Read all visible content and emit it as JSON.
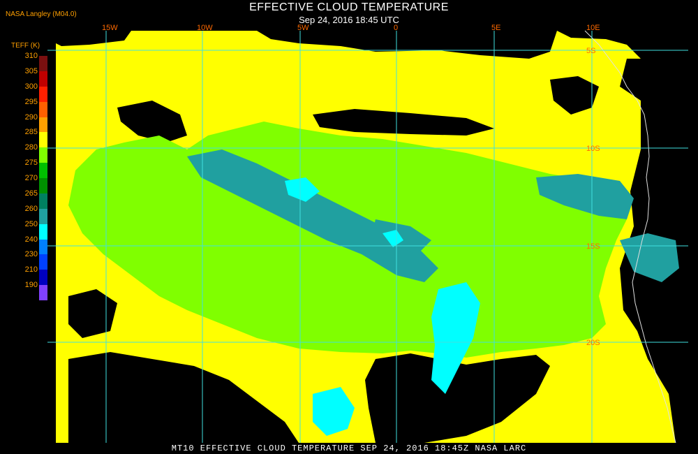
{
  "header": {
    "credit": "NASA Langley (M04.0)",
    "title": "EFFECTIVE CLOUD TEMPERATURE",
    "subtitle": "Sep 24, 2016 18:45 UTC"
  },
  "legend": {
    "title": "TEFF (K)",
    "entries": [
      {
        "value": "310",
        "color": "#7a1010"
      },
      {
        "value": "305",
        "color": "#c00000"
      },
      {
        "value": "300",
        "color": "#ff2000"
      },
      {
        "value": "295",
        "color": "#ff6000"
      },
      {
        "value": "290",
        "color": "#ffa000"
      },
      {
        "value": "285",
        "color": "#ffff00"
      },
      {
        "value": "280",
        "color": "#80ff00"
      },
      {
        "value": "275",
        "color": "#00c000"
      },
      {
        "value": "270",
        "color": "#009000"
      },
      {
        "value": "265",
        "color": "#008060"
      },
      {
        "value": "260",
        "color": "#20a0a0"
      },
      {
        "value": "250",
        "color": "#00ffff"
      },
      {
        "value": "240",
        "color": "#0080ff"
      },
      {
        "value": "230",
        "color": "#0040ff"
      },
      {
        "value": "210",
        "color": "#0000c0"
      },
      {
        "value": "190",
        "color": "#8040ff"
      }
    ]
  },
  "map": {
    "longitude_labels": [
      "15W",
      "10W",
      "5W",
      "0",
      "5E",
      "10E"
    ],
    "latitude_labels": [
      "5S",
      "10S",
      "15S",
      "20S"
    ],
    "grid_color": "#40e0e0",
    "label_color": "#ff6a00",
    "clear_sky_color": "#000000"
  },
  "footer": {
    "text": "MT10   EFFECTIVE CLOUD TEMPERATURE   SEP 24, 2016 18:45Z   NASA LARC"
  }
}
